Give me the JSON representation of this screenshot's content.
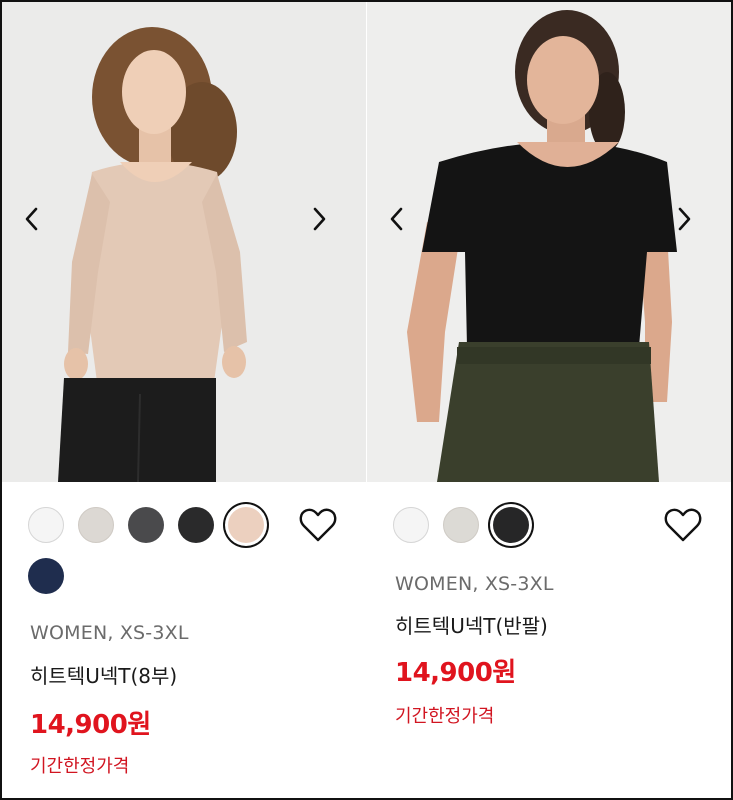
{
  "products": [
    {
      "label": "WOMEN, XS-3XL",
      "name": "히트텍U넥T(8부)",
      "price": "14,900원",
      "promo": "기간한정가격",
      "swatches": [
        {
          "color": "#f5f5f5",
          "selected": false
        },
        {
          "color": "#dcd8d3",
          "selected": false
        },
        {
          "color": "#4a4a4c",
          "selected": false
        },
        {
          "color": "#2a2a2b",
          "selected": false
        },
        {
          "color": "#ecd0bf",
          "selected": true
        },
        {
          "color": "#1f2d4e",
          "selected": false
        }
      ],
      "photo": {
        "shirt_color": "#e3c9b6",
        "pants_color": "#1c1c1c",
        "hair_color": "#7a5232",
        "bg": "#ebebea"
      }
    },
    {
      "label": "WOMEN, XS-3XL",
      "name": "히트텍U넥T(반팔)",
      "price": "14,900원",
      "promo": "기간한정가격",
      "swatches": [
        {
          "color": "#f5f5f5",
          "selected": false
        },
        {
          "color": "#dcdad5",
          "selected": false
        },
        {
          "color": "#262627",
          "selected": true
        }
      ],
      "photo": {
        "shirt_color": "#141414",
        "pants_color": "#3a3f2c",
        "hair_color": "#3a2a22",
        "bg": "#eeeeed"
      }
    }
  ],
  "icons": {
    "prev": "chevron-left-icon",
    "next": "chevron-right-icon",
    "wishlist": "heart-icon"
  }
}
